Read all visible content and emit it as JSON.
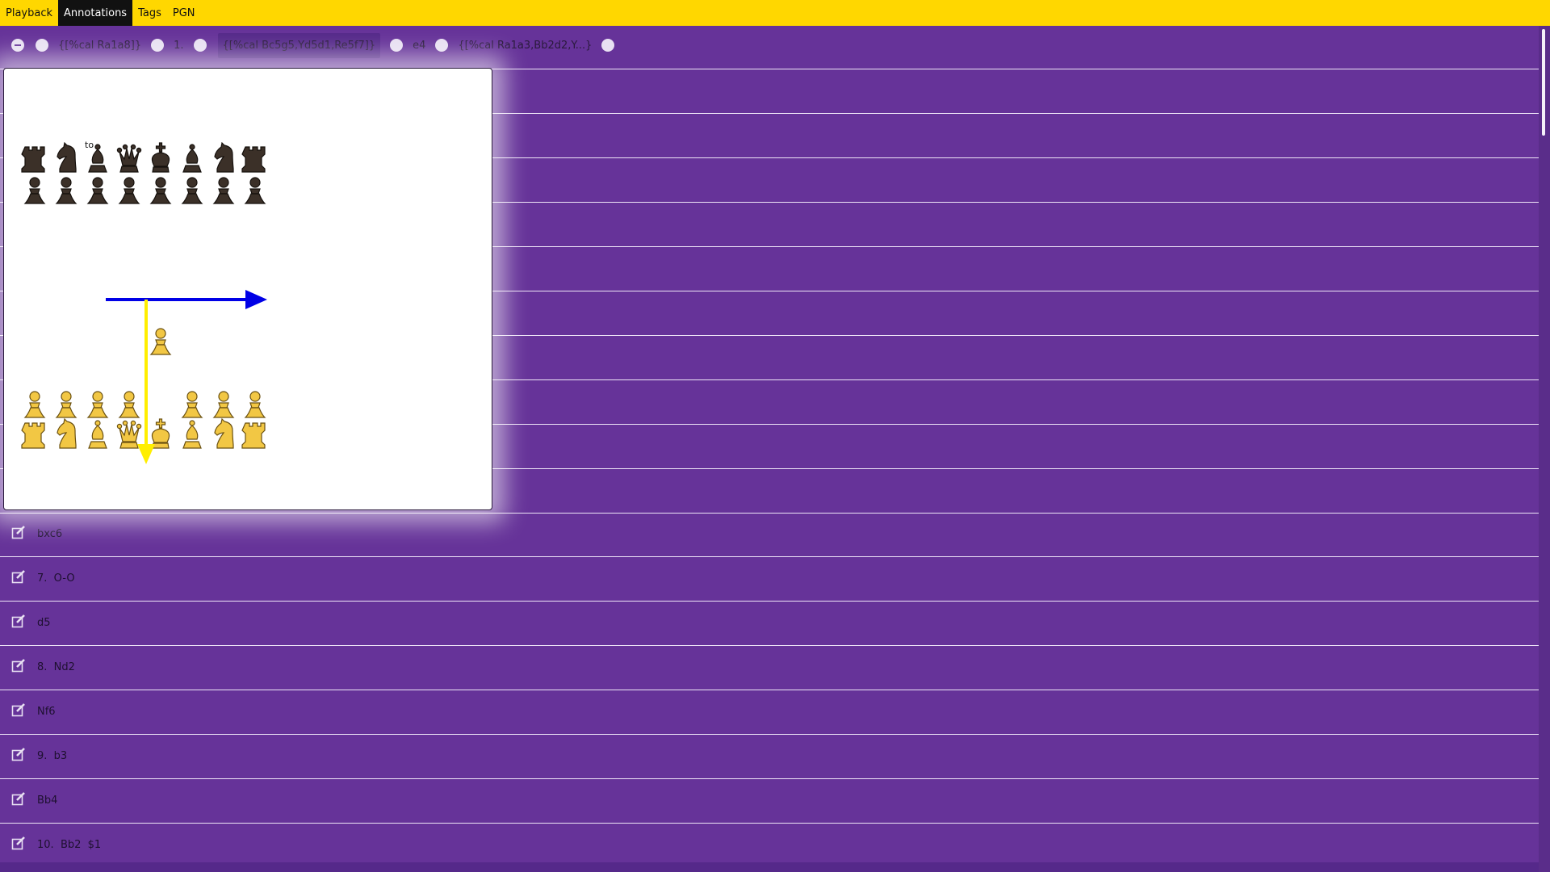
{
  "tabs": [
    {
      "label": "Playback"
    },
    {
      "label": "Annotations"
    },
    {
      "label": "Tags"
    },
    {
      "label": "PGN"
    }
  ],
  "controls": {
    "comment1": "{[%cal Ra1a8]}",
    "move_number": "1.",
    "comment2": "{[%cal Bc5g5,Yd5d1,Re5f7]}",
    "move": "e4",
    "comment3": "{[%cal Ra1a3,Bb2d2,Y...}"
  },
  "popup": {
    "label": "to",
    "arrows": [
      {
        "from": "c5",
        "to": "g5",
        "color": "#0000e6"
      },
      {
        "from": "d5",
        "to": "d1",
        "color": "#ffee00"
      }
    ]
  },
  "rows": [
    {
      "label": "bxc6"
    },
    {
      "label": "7.  O-O"
    },
    {
      "label": "d5"
    },
    {
      "label": "8.  Nd2"
    },
    {
      "label": "Nf6"
    },
    {
      "label": "9.  b3"
    },
    {
      "label": "Bb4"
    },
    {
      "label": "10.  Bb2  $1"
    }
  ],
  "colors": {
    "topbar": "#ffd700",
    "background": "#663399",
    "white_pieces": "#f2c744",
    "black_pieces": "#3b3028"
  }
}
